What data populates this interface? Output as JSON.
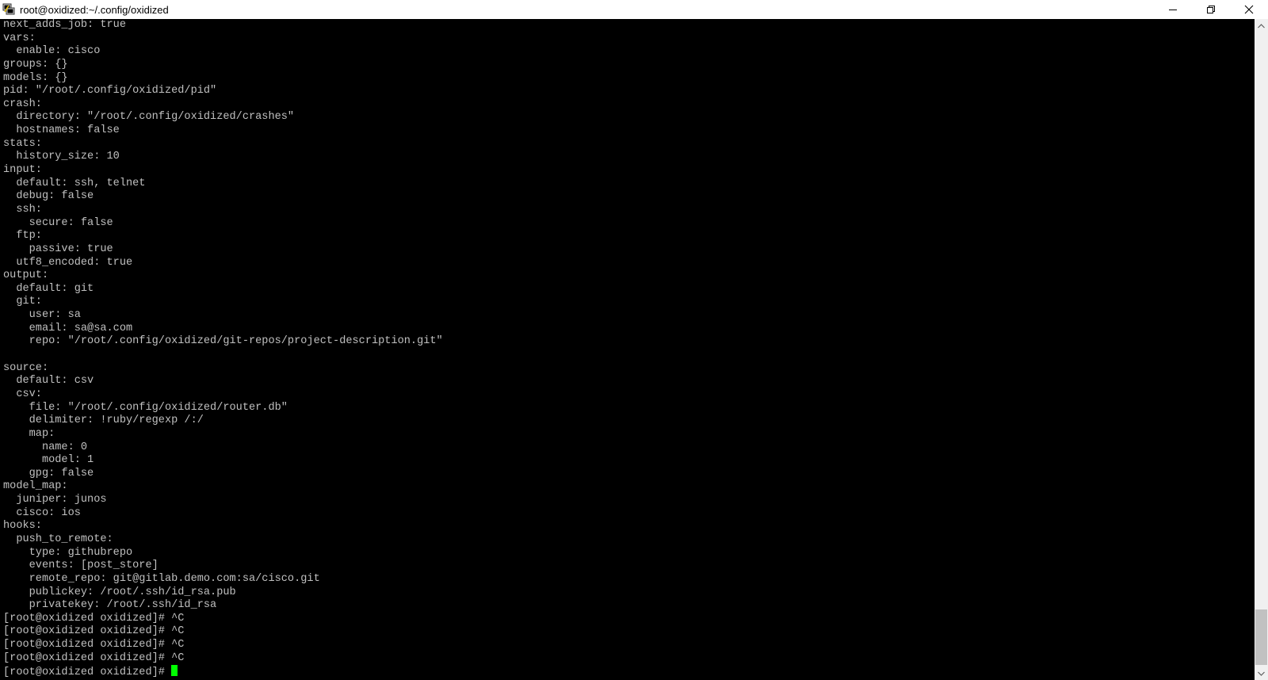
{
  "window": {
    "title": "root@oxidized:~/.config/oxidized",
    "icon": "putty-icon"
  },
  "controls": {
    "minimize": "minimize-icon",
    "restore": "restore-icon",
    "close": "close-icon"
  },
  "terminal": {
    "fg_color": "#c0c0c0",
    "bg_color": "#000000",
    "cursor_color": "#00ff00",
    "lines": [
      "next_adds_job: true",
      "vars:",
      "  enable: cisco",
      "groups: {}",
      "models: {}",
      "pid: \"/root/.config/oxidized/pid\"",
      "crash:",
      "  directory: \"/root/.config/oxidized/crashes\"",
      "  hostnames: false",
      "stats:",
      "  history_size: 10",
      "input:",
      "  default: ssh, telnet",
      "  debug: false",
      "  ssh:",
      "    secure: false",
      "  ftp:",
      "    passive: true",
      "  utf8_encoded: true",
      "output:",
      "  default: git",
      "  git:",
      "    user: sa",
      "    email: sa@sa.com",
      "    repo: \"/root/.config/oxidized/git-repos/project-description.git\"",
      "",
      "source:",
      "  default: csv",
      "  csv:",
      "    file: \"/root/.config/oxidized/router.db\"",
      "    delimiter: !ruby/regexp /:/",
      "    map:",
      "      name: 0",
      "      model: 1",
      "    gpg: false",
      "model_map:",
      "  juniper: junos",
      "  cisco: ios",
      "hooks:",
      "  push_to_remote:",
      "    type: githubrepo",
      "    events: [post_store]",
      "    remote_repo: git@gitlab.demo.com:sa/cisco.git",
      "    publickey: /root/.ssh/id_rsa.pub",
      "    privatekey: /root/.ssh/id_rsa",
      "[root@oxidized oxidized]# ^C",
      "[root@oxidized oxidized]# ^C",
      "[root@oxidized oxidized]# ^C",
      "[root@oxidized oxidized]# ^C"
    ],
    "prompt": "[root@oxidized oxidized]# "
  },
  "scrollbar": {
    "up": "scroll-up-arrow-icon",
    "down": "scroll-down-arrow-icon"
  }
}
